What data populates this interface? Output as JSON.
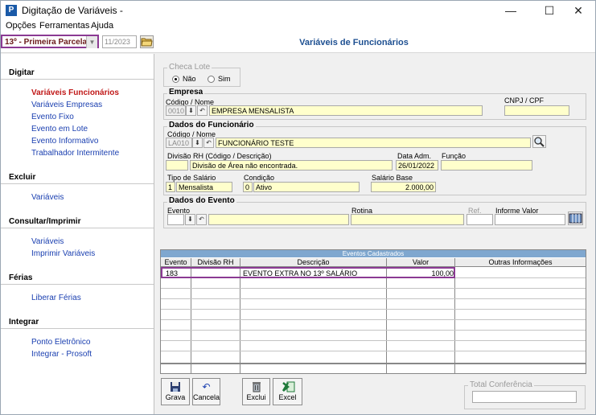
{
  "window": {
    "title": "Digitação de Variáveis - ",
    "minimize": "—",
    "maximize": "☐",
    "close": "✕"
  },
  "menu": [
    "Opções",
    "Ferramentas",
    "Ajuda"
  ],
  "toolbar": {
    "period": "13º - Primeira Parcela",
    "date": "11/2023"
  },
  "header": {
    "title": "Variáveis de Funcionários"
  },
  "sidebar": {
    "digitar": {
      "title": "Digitar",
      "items": [
        "Variáveis Funcionários",
        "Variáveis Empresas",
        "Evento Fixo",
        "Evento em Lote",
        "Evento Informativo",
        "Trabalhador Intermitente"
      ]
    },
    "excluir": {
      "title": "Excluir",
      "items": [
        "Variáveis"
      ]
    },
    "consultar": {
      "title": "Consultar/Imprimir",
      "items": [
        "Variáveis",
        "Imprimir Variáveis"
      ]
    },
    "ferias": {
      "title": "Férias",
      "items": [
        "Liberar Férias"
      ]
    },
    "integrar": {
      "title": "Integrar",
      "items": [
        "Ponto Eletrônico",
        "Integrar - Prosoft"
      ]
    }
  },
  "checa_lote": {
    "title": "Checa Lote",
    "nao": "Não",
    "sim": "Sim",
    "selected": "Não"
  },
  "empresa": {
    "title": "Empresa",
    "label": "Código / Nome",
    "codigo": "0010",
    "nome": "EMPRESA MENSALISTA",
    "cnpj_label": "CNPJ / CPF",
    "cnpj": ""
  },
  "funcionario": {
    "title": "Dados do Funcionário",
    "label": "Código / Nome",
    "codigo": "LA010",
    "nome": "FUNCIONÁRIO TESTE",
    "divisao_label": "Divisão RH (Código / Descrição)",
    "divisao_codigo": "",
    "divisao_desc": "Divisão de Área não encontrada.",
    "data_adm_label": "Data Adm.",
    "data_adm": "26/01/2022",
    "funcao_label": "Função",
    "funcao": "",
    "tipo_label": "Tipo de Salário",
    "tipo_codigo": "1",
    "tipo_desc": "Mensalista",
    "condicao_label": "Condição",
    "condicao_codigo": "0",
    "condicao_desc": "Ativo",
    "salario_label": "Salário Base",
    "salario": "2.000,00"
  },
  "evento": {
    "title": "Dados do Evento",
    "evento_label": "Evento",
    "rotina_label": "Rotina",
    "ref_label": "Ref.",
    "informe_label": "Informe Valor"
  },
  "grid": {
    "title": "Eventos Cadastrados",
    "columns": [
      "Evento",
      "Divisão RH",
      "Descrição",
      "Valor",
      "Outras Informações"
    ],
    "rows": [
      {
        "evento": "183",
        "divisao": "",
        "descricao": "EVENTO EXTRA NO 13º SALÁRIO",
        "valor": "100,00",
        "outras": ""
      }
    ]
  },
  "buttons": {
    "grava": "Grava",
    "cancela": "Cancela",
    "exclui": "Exclui",
    "excel": "Excel"
  },
  "total": {
    "label": "Total Conferência",
    "value": ""
  },
  "colors": {
    "accent": "#1d4f91",
    "active_link": "#c01818",
    "link": "#1a3fb0",
    "highlight": "#8b3a93",
    "required": "#ffffcc"
  }
}
